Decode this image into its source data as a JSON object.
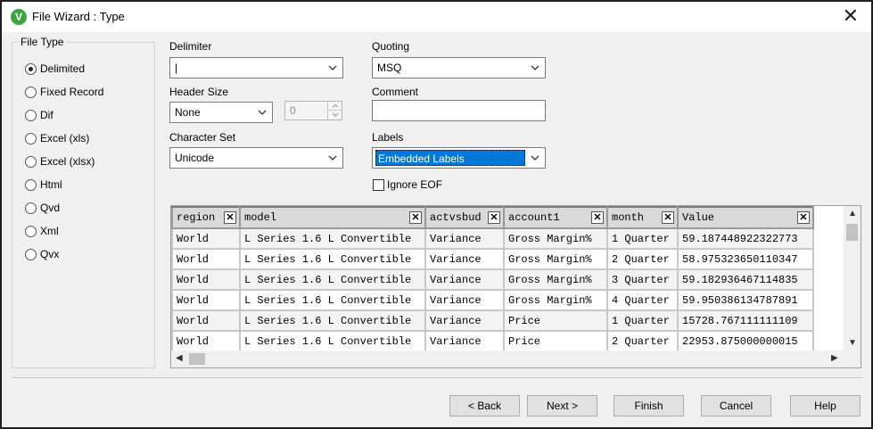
{
  "window": {
    "title": "File Wizard : Type",
    "app_icon_letter": "V"
  },
  "file_type": {
    "legend": "File Type",
    "options": [
      {
        "label": "Delimited",
        "checked": true
      },
      {
        "label": "Fixed Record",
        "checked": false
      },
      {
        "label": "Dif",
        "checked": false
      },
      {
        "label": "Excel (xls)",
        "checked": false
      },
      {
        "label": "Excel (xlsx)",
        "checked": false
      },
      {
        "label": "Html",
        "checked": false
      },
      {
        "label": "Qvd",
        "checked": false
      },
      {
        "label": "Xml",
        "checked": false
      },
      {
        "label": "Qvx",
        "checked": false
      }
    ]
  },
  "delimiter": {
    "label": "Delimiter",
    "value": "|"
  },
  "header_size": {
    "label": "Header Size",
    "value": "None",
    "spinner_value": "0"
  },
  "character_set": {
    "label": "Character Set",
    "value": "Unicode"
  },
  "quoting": {
    "label": "Quoting",
    "value": "MSQ"
  },
  "comment": {
    "label": "Comment",
    "value": ""
  },
  "labels": {
    "label": "Labels",
    "value": "Embedded Labels"
  },
  "ignore_eof": {
    "label": "Ignore EOF",
    "checked": false
  },
  "table": {
    "columns": [
      "region",
      "model",
      "actvsbud",
      "account1",
      "month",
      "Value"
    ],
    "rows": [
      [
        "World",
        "L Series 1.6 L Convertible",
        "Variance",
        "Gross Margin%",
        "1 Quarter",
        "59.187448922322773"
      ],
      [
        "World",
        "L Series 1.6 L Convertible",
        "Variance",
        "Gross Margin%",
        "2 Quarter",
        "58.975323650110347"
      ],
      [
        "World",
        "L Series 1.6 L Convertible",
        "Variance",
        "Gross Margin%",
        "3 Quarter",
        "59.182936467114835"
      ],
      [
        "World",
        "L Series 1.6 L Convertible",
        "Variance",
        "Gross Margin%",
        "4 Quarter",
        "59.950386134787891"
      ],
      [
        "World",
        "L Series 1.6 L Convertible",
        "Variance",
        "Price",
        "1 Quarter",
        "15728.767111111109"
      ],
      [
        "World",
        "L Series 1.6 L Convertible",
        "Variance",
        "Price",
        "2 Quarter",
        "22953.875000000015"
      ]
    ]
  },
  "buttons": {
    "back": "< Back",
    "next": "Next >",
    "finish": "Finish",
    "cancel": "Cancel",
    "help": "Help"
  }
}
